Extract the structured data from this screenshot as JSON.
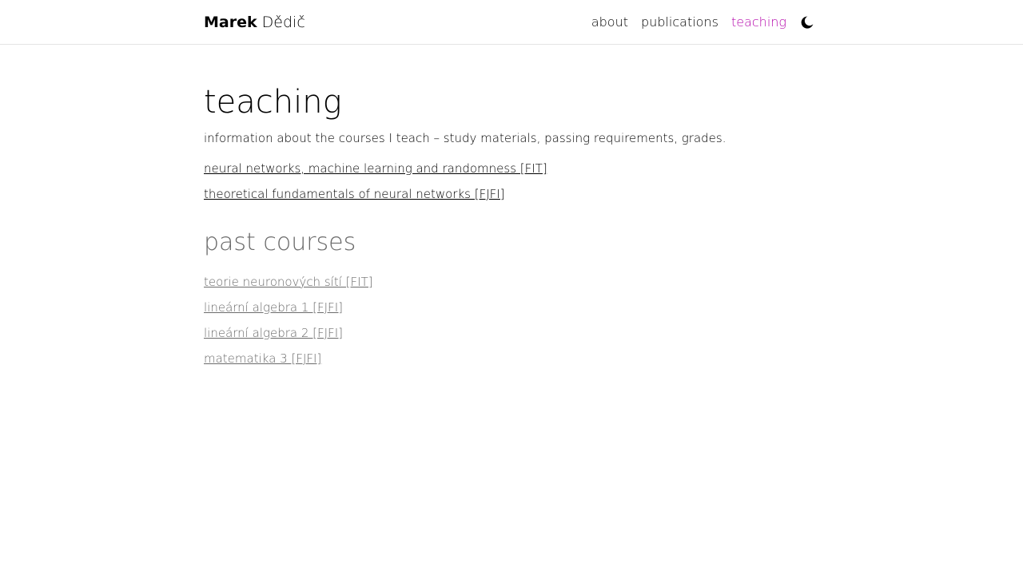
{
  "brand": {
    "first_name": "Marek",
    "last_name": "Dědič"
  },
  "nav": {
    "items": [
      {
        "label": "about",
        "active": false
      },
      {
        "label": "publications",
        "active": false
      },
      {
        "label": "teaching",
        "active": true
      }
    ],
    "theme_toggle_icon": "moon-icon",
    "active_color": "#b509ac"
  },
  "main": {
    "title": "teaching",
    "description": "information about the courses I teach – study materials, passing requirements, grades.",
    "courses": [
      {
        "label": "neural networks, machine learning and randomness [FIT]"
      },
      {
        "label": "theoretical fundamentals of neural networks [FJFI]"
      }
    ],
    "past_title": "past courses",
    "past_courses": [
      {
        "label": "teorie neuronových sítí [FIT]"
      },
      {
        "label": "lineární algebra 1 [FJFI]"
      },
      {
        "label": "lineární algebra 2 [FJFI]"
      },
      {
        "label": "matematika 3 [FJFI]"
      }
    ]
  }
}
